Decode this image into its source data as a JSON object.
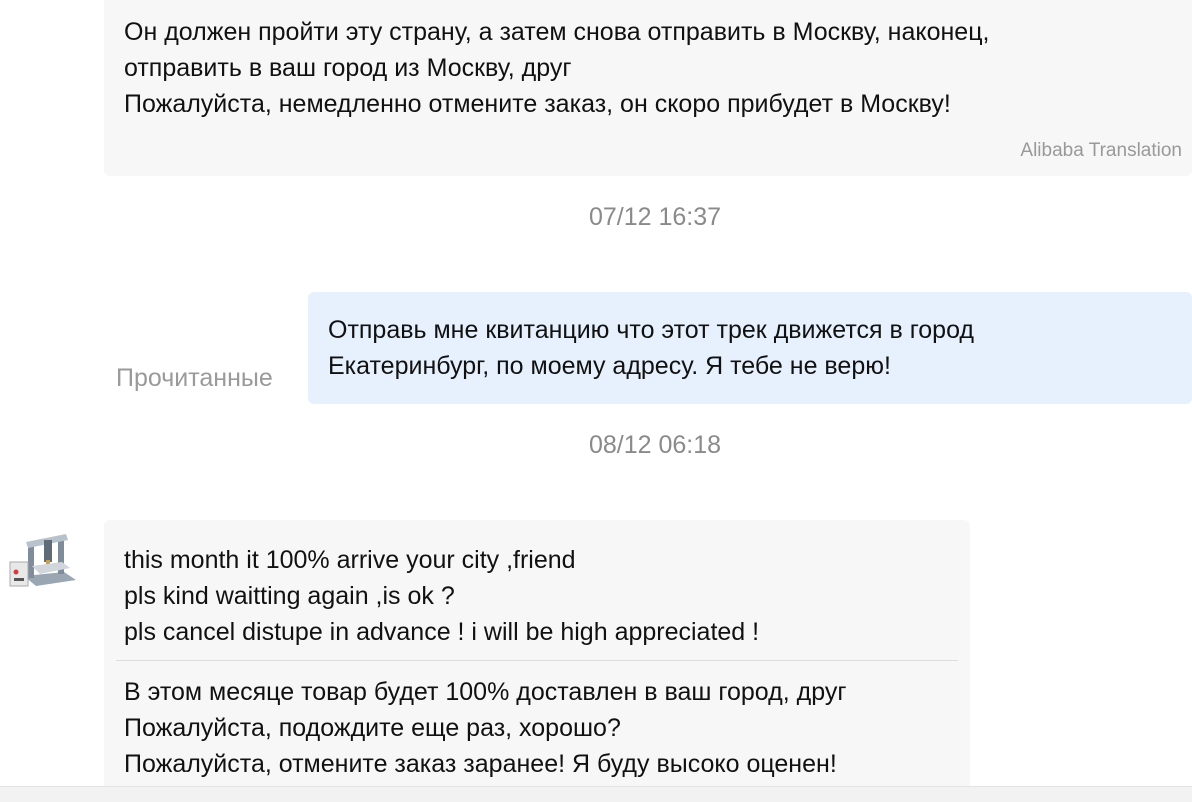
{
  "messages": [
    {
      "lines": [
        "Он должен пройти эту страну, а затем снова отправить в Москву, наконец,",
        "отправить в ваш город из Москву, друг",
        "Пожалуйста, немедленно отмените заказ, он скоро прибудет в Москву!"
      ],
      "translation_credit": "Alibaba Translation"
    },
    {
      "timestamp": "07/12 16:37",
      "read_status": "Прочитанные",
      "lines": [
        "Отправь мне квитанцию что этот трек движется в город",
        "Екатеринбург, по моему адресу. Я тебе не верю!"
      ]
    },
    {
      "timestamp": "08/12 06:18",
      "original_lines": [
        "this month it 100% arrive your city ,friend",
        "pls kind waitting again ,is ok ?",
        "pls cancel distupe in advance ! i will be high appreciated !"
      ],
      "translated_lines": [
        "В этом месяце товар будет 100% доставлен в ваш город, друг",
        "Пожалуйста, подождите еще раз, хорошо?",
        "Пожалуйста, отмените заказ заранее! Я буду высоко оценен!"
      ]
    }
  ],
  "avatar": {
    "icon": "cnc-machine-product-avatar"
  },
  "colors": {
    "incoming_bubble": "#f7f7f7",
    "outgoing_bubble": "#e6f1fd",
    "timestamp_text": "#8a8a8a",
    "meta_text": "#999999"
  }
}
